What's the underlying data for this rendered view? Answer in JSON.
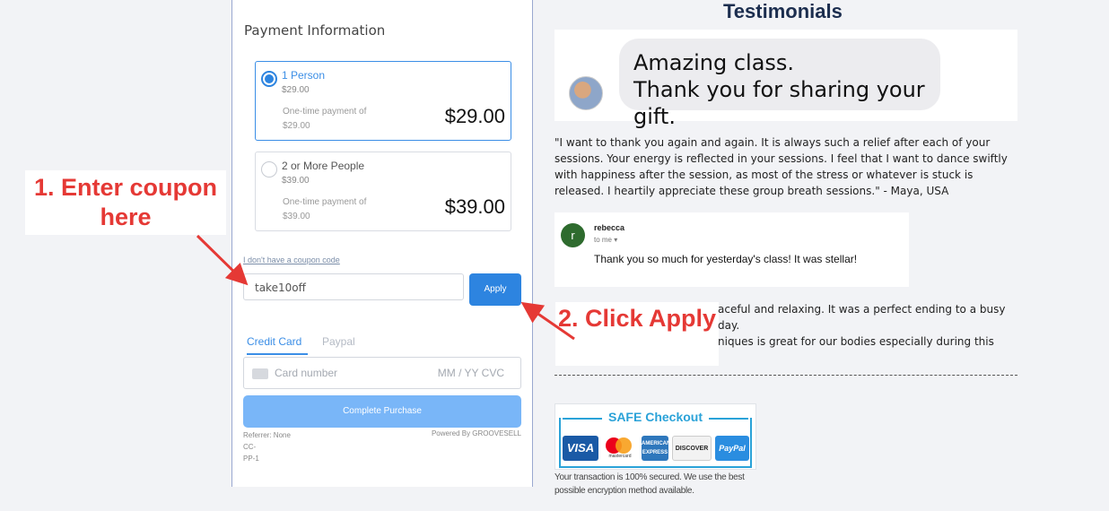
{
  "payment": {
    "title": "Payment Information",
    "options": [
      {
        "name": "1 Person",
        "sub_price": "$29.00",
        "desc": "One-time payment of $29.00",
        "price": "$29.00",
        "selected": true
      },
      {
        "name": "2 or More People",
        "sub_price": "$39.00",
        "desc": "One-time payment of $39.00",
        "price": "$39.00",
        "selected": false
      }
    ],
    "no_coupon_link": "I don't have a coupon code",
    "coupon_value": "take10off",
    "apply_label": "Apply",
    "tabs": [
      "Credit Card",
      "Paypal"
    ],
    "card_placeholder": "Card number",
    "card_placeholder_right": "MM / YY  CVC",
    "complete_label": "Complete Purchase",
    "referrer_lines": [
      "Referrer: None",
      "CC-",
      "PP-1"
    ],
    "powered_by": "Powered By GROOVESELL"
  },
  "callouts": {
    "step1": "1. Enter coupon here",
    "step2": "2. Click Apply",
    "color": "#e53935"
  },
  "testimonials": {
    "title": "Testimonials",
    "bubble_line1": "Amazing class.",
    "bubble_line2": "Thank you for sharing your gift.",
    "quote": "\"I want to thank you again and again. It is always such a relief after each of your sessions. Your energy is reflected in your sessions. I feel that I want to dance swiftly with happiness after the session, as most of the stress or whatever is stuck is released. I heartily appreciate these group breath sessions.\" - Maya, USA",
    "email": {
      "avatar_letter": "r",
      "sender": "rebecca",
      "to": "to me ▾",
      "body": "Thank you so much for yesterday's class!  It was stellar!"
    },
    "quote2_line1": "aceful and relaxing. It was a perfect ending to a busy day.",
    "quote2_line2": "niques is great for our bodies especially during this"
  },
  "safe_checkout": {
    "title": "SAFE Checkout",
    "logos": [
      "VISA",
      "mastercard",
      "AMERICAN EXPRESS",
      "DISCOVER",
      "PayPal"
    ],
    "caption": "Your transaction is 100% secured. We use the best possible encryption method available."
  }
}
